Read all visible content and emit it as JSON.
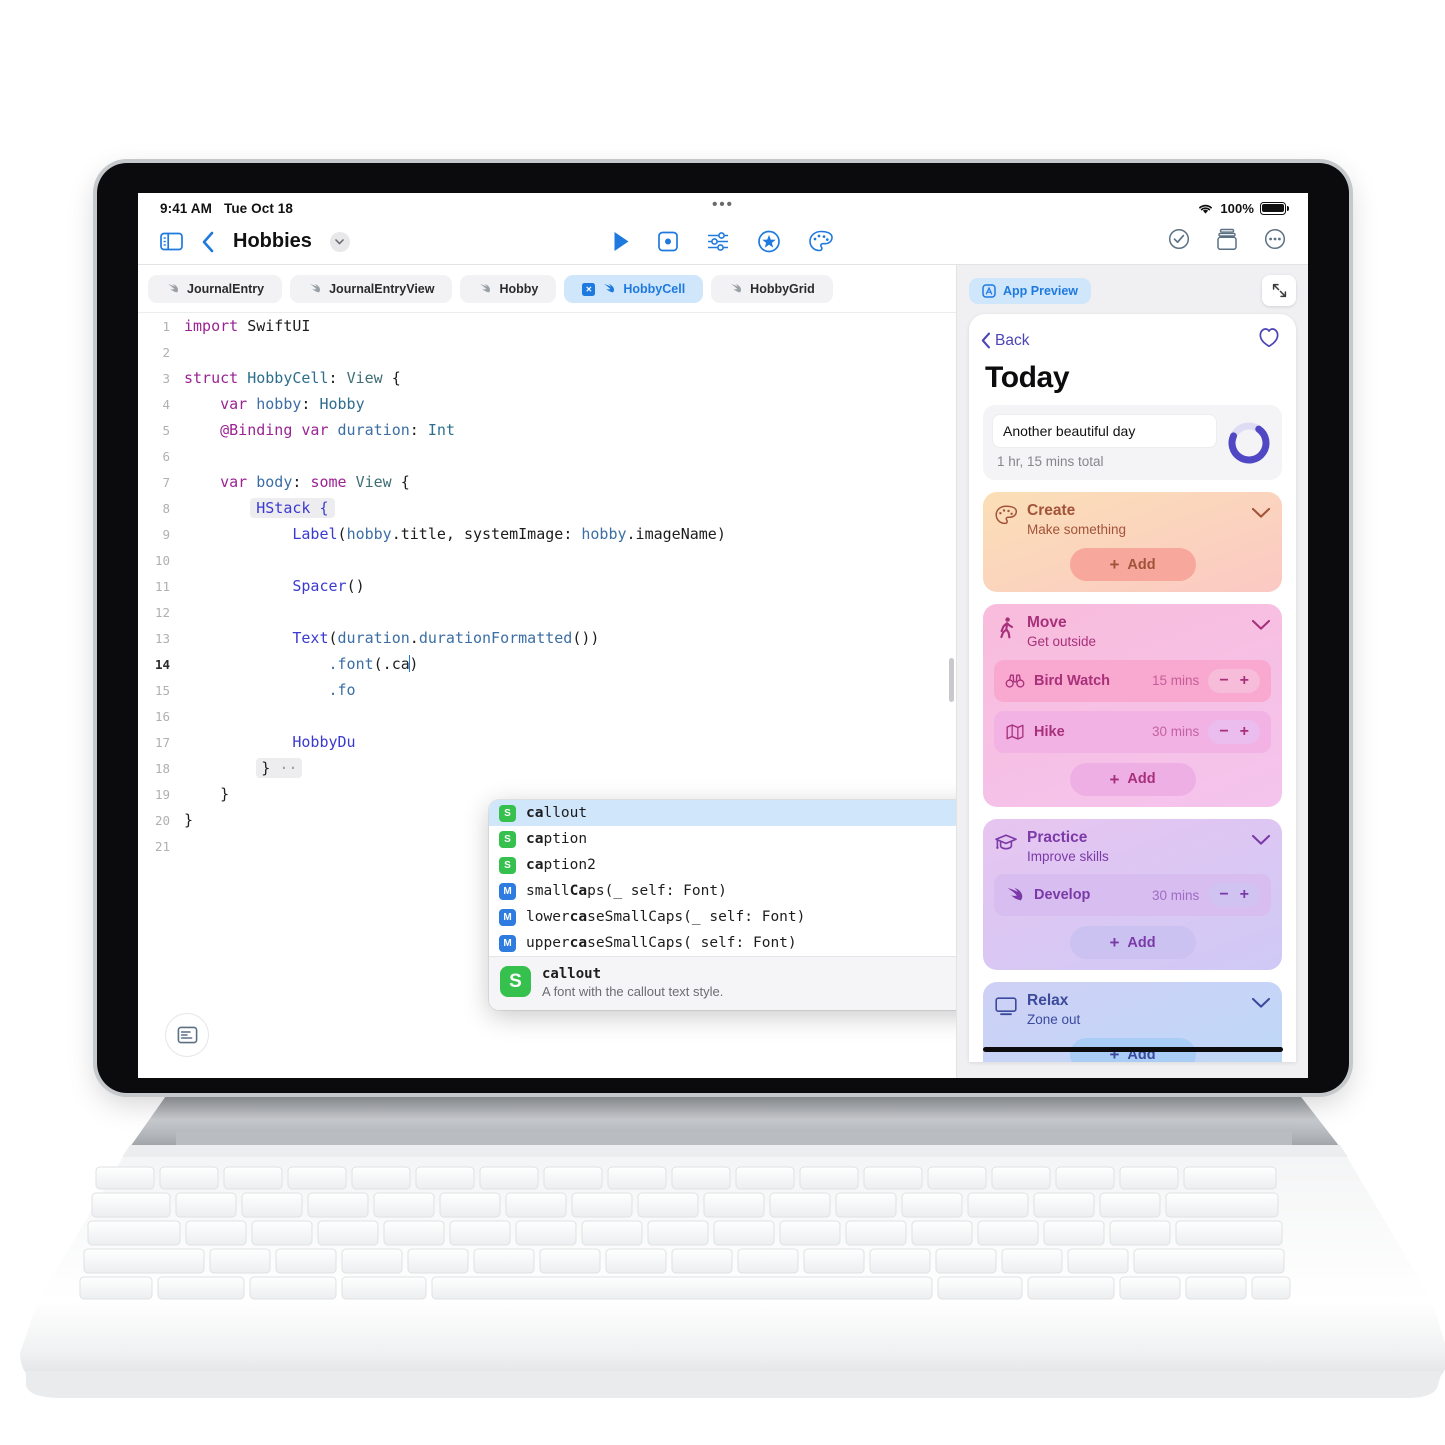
{
  "status_bar": {
    "time": "9:41 AM",
    "date": "Tue Oct 18",
    "battery_pct": "100%",
    "wifi_icon": "wifi-icon",
    "battery_icon": "battery-icon",
    "dots_icon": "dynamic-island-dots-icon"
  },
  "toolbar": {
    "sidebar_icon": "sidebar-toggle-icon",
    "back_icon": "chevron-left-icon",
    "project_title": "Hobbies",
    "title_chevron_icon": "chevron-down-icon",
    "run_icon": "play-icon",
    "preview_icon": "device-preview-icon",
    "adjust_icon": "sliders-icon",
    "star_icon": "star-circle-icon",
    "palette_icon": "palette-icon",
    "check_icon": "checkmark-circle-icon",
    "library_icon": "library-icon",
    "more_icon": "ellipsis-circle-icon"
  },
  "tabs": [
    {
      "label": "JournalEntry",
      "active": false,
      "icon": "swift-file-icon"
    },
    {
      "label": "JournalEntryView",
      "active": false,
      "icon": "swift-file-icon"
    },
    {
      "label": "Hobby",
      "active": false,
      "icon": "swift-file-icon"
    },
    {
      "label": "HobbyCell",
      "active": true,
      "icon": "swift-file-icon",
      "close_icon": "close-icon"
    },
    {
      "label": "HobbyGrid",
      "active": false,
      "icon": "swift-file-icon"
    }
  ],
  "editor": {
    "current_line": "14",
    "minimap_icon": "minimap-icon",
    "lines": [
      {
        "n": "1",
        "tokens": [
          {
            "t": "import ",
            "c": "kw"
          },
          {
            "t": "SwiftUI",
            "c": "plain"
          }
        ]
      },
      {
        "n": "2",
        "tokens": []
      },
      {
        "n": "3",
        "tokens": [
          {
            "t": "struct ",
            "c": "kw"
          },
          {
            "t": "HobbyCell",
            "c": "typeb"
          },
          {
            "t": ": ",
            "c": "plain"
          },
          {
            "t": "View",
            "c": "type"
          },
          {
            "t": " {",
            "c": "plain"
          }
        ]
      },
      {
        "n": "4",
        "tokens": [
          {
            "t": "    ",
            "c": "plain"
          },
          {
            "t": "var ",
            "c": "kw"
          },
          {
            "t": "hobby",
            "c": "prop"
          },
          {
            "t": ": ",
            "c": "plain"
          },
          {
            "t": "Hobby",
            "c": "typeb"
          }
        ]
      },
      {
        "n": "5",
        "tokens": [
          {
            "t": "    ",
            "c": "plain"
          },
          {
            "t": "@Binding ",
            "c": "attr"
          },
          {
            "t": "var ",
            "c": "kw"
          },
          {
            "t": "duration",
            "c": "prop"
          },
          {
            "t": ": ",
            "c": "plain"
          },
          {
            "t": "Int",
            "c": "typeb"
          }
        ]
      },
      {
        "n": "6",
        "tokens": []
      },
      {
        "n": "7",
        "tokens": [
          {
            "t": "    ",
            "c": "plain"
          },
          {
            "t": "var ",
            "c": "kw"
          },
          {
            "t": "body",
            "c": "prop"
          },
          {
            "t": ": ",
            "c": "plain"
          },
          {
            "t": "some ",
            "c": "kw"
          },
          {
            "t": "View",
            "c": "type"
          },
          {
            "t": " {",
            "c": "plain"
          }
        ]
      },
      {
        "n": "8",
        "highlight": true,
        "tokens": [
          {
            "t": "        ",
            "c": "plain"
          },
          {
            "t": "HStack {",
            "c": "fn"
          }
        ]
      },
      {
        "n": "9",
        "tokens": [
          {
            "t": "            ",
            "c": "plain"
          },
          {
            "t": "Label",
            "c": "fn"
          },
          {
            "t": "(",
            "c": "plain"
          },
          {
            "t": "hobby",
            "c": "prop"
          },
          {
            "t": ".title, ",
            "c": "plain"
          },
          {
            "t": "systemImage",
            "c": "plain"
          },
          {
            "t": ": ",
            "c": "plain"
          },
          {
            "t": "hobby",
            "c": "prop"
          },
          {
            "t": ".imageName)",
            "c": "plain"
          }
        ]
      },
      {
        "n": "10",
        "tokens": []
      },
      {
        "n": "11",
        "tokens": [
          {
            "t": "            ",
            "c": "plain"
          },
          {
            "t": "Spacer",
            "c": "fn"
          },
          {
            "t": "()",
            "c": "plain"
          }
        ]
      },
      {
        "n": "12",
        "tokens": []
      },
      {
        "n": "13",
        "tokens": [
          {
            "t": "            ",
            "c": "plain"
          },
          {
            "t": "Text",
            "c": "fn"
          },
          {
            "t": "(",
            "c": "plain"
          },
          {
            "t": "duration",
            "c": "prop"
          },
          {
            "t": ".",
            "c": "plain"
          },
          {
            "t": "durationFormatted",
            "c": "prop"
          },
          {
            "t": "())",
            "c": "plain"
          }
        ]
      },
      {
        "n": "14",
        "current": true,
        "caret": true,
        "tokens": [
          {
            "t": "                ",
            "c": "plain"
          },
          {
            "t": ".font",
            "c": "prop"
          },
          {
            "t": "(.ca",
            "c": "plain"
          }
        ],
        "tail": ")"
      },
      {
        "n": "15",
        "tokens": [
          {
            "t": "                ",
            "c": "plain"
          },
          {
            "t": ".fo",
            "c": "prop"
          }
        ]
      },
      {
        "n": "16",
        "tokens": []
      },
      {
        "n": "17",
        "tokens": [
          {
            "t": "            ",
            "c": "plain"
          },
          {
            "t": "HobbyDu",
            "c": "fn"
          }
        ]
      },
      {
        "n": "18",
        "fold": true,
        "tokens": [
          {
            "t": "        ",
            "c": "plain"
          },
          {
            "t": "}",
            "c": "plain"
          }
        ]
      },
      {
        "n": "19",
        "tokens": [
          {
            "t": "    }",
            "c": "plain"
          }
        ]
      },
      {
        "n": "20",
        "tokens": [
          {
            "t": "}",
            "c": "plain"
          }
        ]
      },
      {
        "n": "21",
        "tokens": []
      }
    ]
  },
  "autocomplete": {
    "enter_icon": "return-key-icon",
    "items": [
      {
        "kind": "S",
        "bold": "ca",
        "rest": "llout",
        "selected": true
      },
      {
        "kind": "S",
        "bold": "ca",
        "rest": "ption",
        "selected": false
      },
      {
        "kind": "S",
        "bold": "ca",
        "rest": "ption2",
        "selected": false
      },
      {
        "kind": "M",
        "pre": "small",
        "bold": "Ca",
        "rest": "ps(_ self: Font)",
        "selected": false
      },
      {
        "kind": "M",
        "pre": "lower",
        "bold": "ca",
        "rest": "seSmallCaps(_ self: Font)",
        "selected": false
      },
      {
        "kind": "M",
        "pre": "upper",
        "bold": "ca",
        "rest": "seSmallCaps(  self: Font)",
        "selected": false
      }
    ],
    "doc": {
      "badge": "S",
      "title": "callout",
      "description": "A font with the callout text style."
    }
  },
  "preview": {
    "chip_label": "App Preview",
    "chip_icon": "app-preview-icon",
    "expand_icon": "expand-diagonal-icon",
    "back_label": "Back",
    "back_icon": "chevron-left-icon",
    "favorite_icon": "heart-icon",
    "title": "Today",
    "summary": {
      "note_value": "Another beautiful day",
      "total_text": "1 hr, 15 mins total",
      "ring_icon": "progress-ring-icon",
      "ring_pct": 72,
      "ring_color": "#4f47c4",
      "ring_track_color": "#dedcf4"
    },
    "categories": [
      {
        "name": "Create",
        "subtitle": "Make something",
        "icon": "palette-icon",
        "chevron_icon": "chevron-down-icon",
        "bg_from": "#fbdfb6",
        "bg_to": "#fbc9c4",
        "text": "#a2533a",
        "add_bg": "#f7a79c",
        "add_label": "Add",
        "add_icon": "plus-icon",
        "items": []
      },
      {
        "name": "Move",
        "subtitle": "Get outside",
        "icon": "walk-icon",
        "chevron_icon": "chevron-down-icon",
        "bg_from": "#f9bcdb",
        "bg_to": "#f4c4ee",
        "text": "#a8307b",
        "add_bg": "#eeb0e4",
        "add_label": "Add",
        "add_icon": "plus-icon",
        "items": [
          {
            "name": "Bird Watch",
            "mins": "15 mins",
            "icon": "binoculars-icon",
            "row_bg": "#f9a8cf",
            "step_bg": "#f7bcd9"
          },
          {
            "name": "Hike",
            "mins": "30 mins",
            "icon": "map-icon",
            "row_bg": "#f2b2e4",
            "step_bg": "#eabdee"
          }
        ]
      },
      {
        "name": "Practice",
        "subtitle": "Improve skills",
        "icon": "graduation-cap-icon",
        "chevron_icon": "chevron-down-icon",
        "bg_from": "#e7c5f0",
        "bg_to": "#cfc9f6",
        "text": "#7b3aa8",
        "add_bg": "#cbc2f2",
        "add_label": "Add",
        "add_icon": "plus-icon",
        "items": [
          {
            "name": "Develop",
            "mins": "30 mins",
            "icon": "swift-bird-icon",
            "row_bg": "#d7bdf0",
            "step_bg": "#d0c2f1"
          }
        ]
      },
      {
        "name": "Relax",
        "subtitle": "Zone out",
        "icon": "display-icon",
        "chevron_icon": "chevron-down-icon",
        "bg_from": "#cfd0f6",
        "bg_to": "#bcd9f8",
        "text": "#3c4a9c",
        "add_bg": "#aacdf6",
        "add_label": "Add",
        "add_icon": "plus-icon",
        "items": []
      }
    ]
  }
}
